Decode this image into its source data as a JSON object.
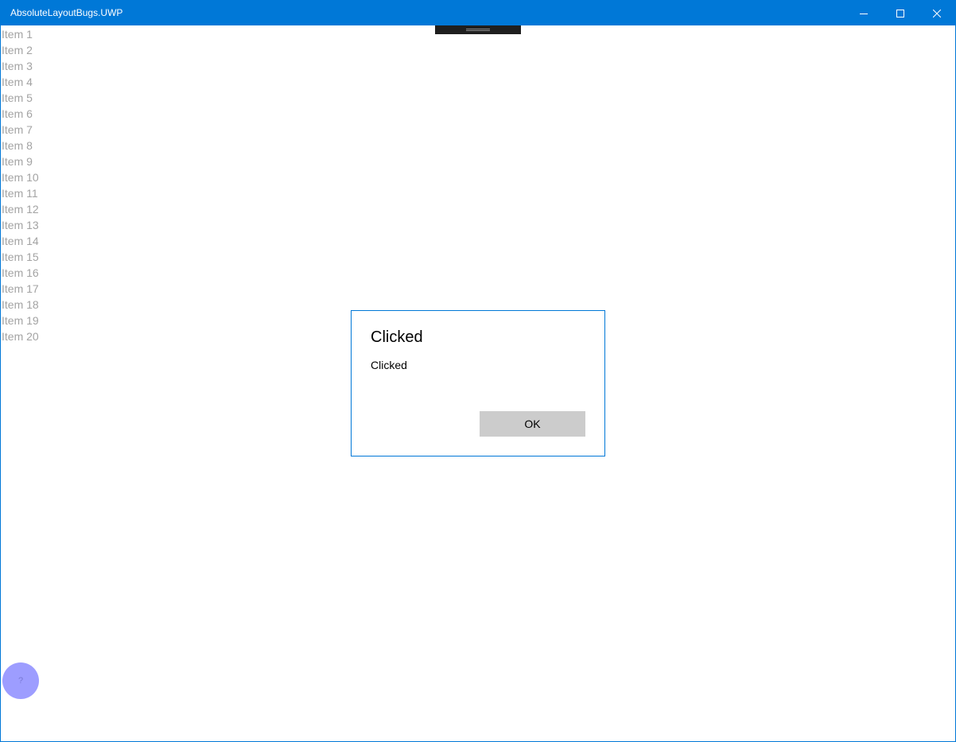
{
  "window": {
    "title": "AbsoluteLayoutBugs.UWP",
    "accent_color": "#0078d7"
  },
  "caption_buttons": {
    "minimize_icon": "minimize-icon",
    "maximize_icon": "maximize-icon",
    "close_icon": "close-icon"
  },
  "list": {
    "items": [
      "Item 1",
      "Item 2",
      "Item 3",
      "Item 4",
      "Item 5",
      "Item 6",
      "Item 7",
      "Item 8",
      "Item 9",
      "Item 10",
      "Item 11",
      "Item 12",
      "Item 13",
      "Item 14",
      "Item 15",
      "Item 16",
      "Item 17",
      "Item 18",
      "Item 19",
      "Item 20"
    ],
    "text_color": "#a3a3a3"
  },
  "dialog": {
    "title": "Clicked",
    "content": "Clicked",
    "ok_label": "OK",
    "button_color": "#cccccc"
  },
  "fab": {
    "label": "?",
    "color": "#9d9dff"
  }
}
